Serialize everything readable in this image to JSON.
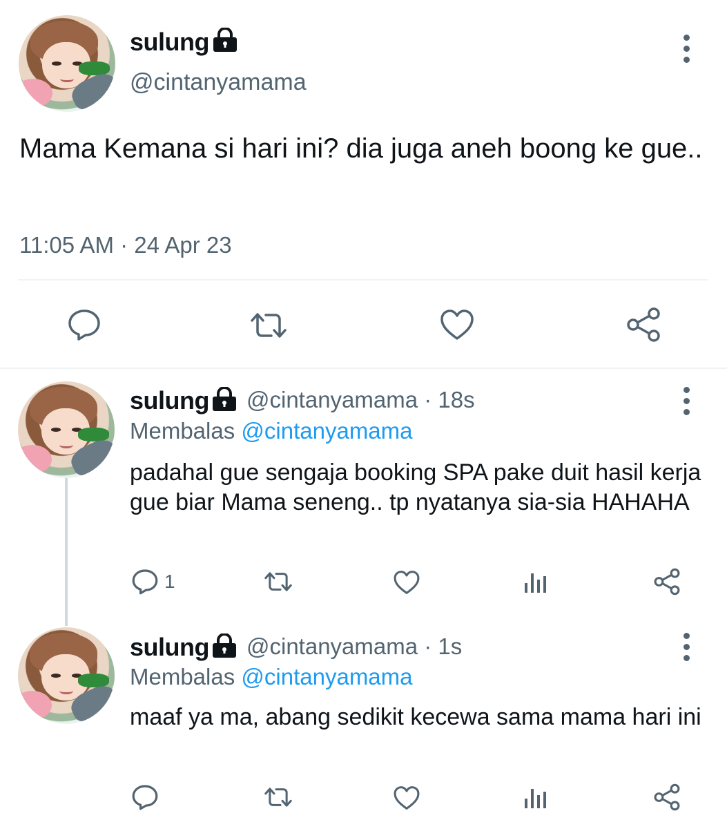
{
  "main_tweet": {
    "name": "sulung",
    "handle": "@cintanyamama",
    "text": "Mama Kemana si hari ini? dia juga aneh boong ke gue..",
    "timestamp": "11:05 AM · 24 Apr 23"
  },
  "replies": [
    {
      "name": "sulung",
      "handle_time": "@cintanyamama · 18s",
      "replying_prefix": "Membalas",
      "replying_to": "@cintanyamama",
      "text": "padahal gue sengaja booking SPA pake duit hasil kerja gue biar Mama seneng.. tp nyatanya sia-sia HAHAHA",
      "reply_count": "1"
    },
    {
      "name": "sulung",
      "handle_time": "@cintanyamama · 1s",
      "replying_prefix": "Membalas",
      "replying_to": "@cintanyamama",
      "text": "maaf ya ma, abang sedikit kecewa sama mama hari ini",
      "reply_count": ""
    }
  ],
  "icons": {
    "reply": "reply-icon",
    "retweet": "retweet-icon",
    "like": "heart-icon",
    "views": "views-icon",
    "share": "share-icon",
    "protected": "lock-icon",
    "more": "more-icon"
  },
  "colors": {
    "text": "#0f1419",
    "secondary": "#536471",
    "link": "#1d9bf0",
    "divider": "#eff3f4"
  }
}
